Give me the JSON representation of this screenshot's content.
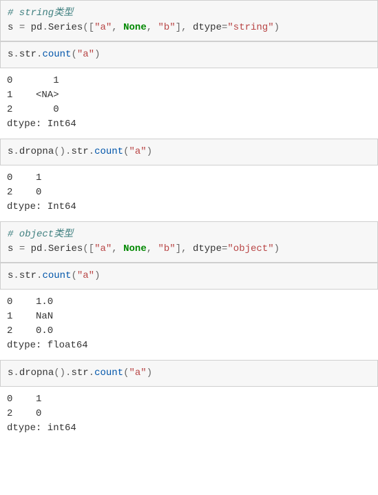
{
  "cells": [
    {
      "type": "in",
      "tokens": [
        {
          "cls": "tok-comment",
          "t": "# string类型"
        },
        {
          "cls": "",
          "t": "\n"
        },
        {
          "cls": "tok-ident",
          "t": "s "
        },
        {
          "cls": "tok-op",
          "t": "="
        },
        {
          "cls": "tok-ident",
          "t": " pd"
        },
        {
          "cls": "tok-op",
          "t": "."
        },
        {
          "cls": "tok-ident",
          "t": "Series"
        },
        {
          "cls": "tok-op",
          "t": "(["
        },
        {
          "cls": "tok-str",
          "t": "\"a\""
        },
        {
          "cls": "tok-op",
          "t": ", "
        },
        {
          "cls": "tok-kw",
          "t": "None"
        },
        {
          "cls": "tok-op",
          "t": ", "
        },
        {
          "cls": "tok-str",
          "t": "\"b\""
        },
        {
          "cls": "tok-op",
          "t": "], "
        },
        {
          "cls": "tok-ident",
          "t": "dtype"
        },
        {
          "cls": "tok-op",
          "t": "="
        },
        {
          "cls": "tok-str",
          "t": "\"string\""
        },
        {
          "cls": "tok-op",
          "t": ")"
        }
      ]
    },
    {
      "type": "in",
      "tokens": [
        {
          "cls": "tok-ident",
          "t": "s"
        },
        {
          "cls": "tok-op",
          "t": "."
        },
        {
          "cls": "tok-ident",
          "t": "str"
        },
        {
          "cls": "tok-op",
          "t": "."
        },
        {
          "cls": "tok-func",
          "t": "count"
        },
        {
          "cls": "tok-op",
          "t": "("
        },
        {
          "cls": "tok-str",
          "t": "\"a\""
        },
        {
          "cls": "tok-op",
          "t": ")"
        }
      ]
    },
    {
      "type": "out",
      "text": "0       1\n1    <NA>\n2       0\ndtype: Int64"
    },
    {
      "type": "in",
      "tokens": [
        {
          "cls": "tok-ident",
          "t": "s"
        },
        {
          "cls": "tok-op",
          "t": "."
        },
        {
          "cls": "tok-ident",
          "t": "dropna"
        },
        {
          "cls": "tok-op",
          "t": "()."
        },
        {
          "cls": "tok-ident",
          "t": "str"
        },
        {
          "cls": "tok-op",
          "t": "."
        },
        {
          "cls": "tok-func",
          "t": "count"
        },
        {
          "cls": "tok-op",
          "t": "("
        },
        {
          "cls": "tok-str",
          "t": "\"a\""
        },
        {
          "cls": "tok-op",
          "t": ")"
        }
      ]
    },
    {
      "type": "out",
      "text": "0    1\n2    0\ndtype: Int64"
    },
    {
      "type": "in",
      "tokens": [
        {
          "cls": "tok-comment",
          "t": "# object类型"
        },
        {
          "cls": "",
          "t": "\n"
        },
        {
          "cls": "tok-ident",
          "t": "s "
        },
        {
          "cls": "tok-op",
          "t": "="
        },
        {
          "cls": "tok-ident",
          "t": " pd"
        },
        {
          "cls": "tok-op",
          "t": "."
        },
        {
          "cls": "tok-ident",
          "t": "Series"
        },
        {
          "cls": "tok-op",
          "t": "(["
        },
        {
          "cls": "tok-str",
          "t": "\"a\""
        },
        {
          "cls": "tok-op",
          "t": ", "
        },
        {
          "cls": "tok-kw",
          "t": "None"
        },
        {
          "cls": "tok-op",
          "t": ", "
        },
        {
          "cls": "tok-str",
          "t": "\"b\""
        },
        {
          "cls": "tok-op",
          "t": "], "
        },
        {
          "cls": "tok-ident",
          "t": "dtype"
        },
        {
          "cls": "tok-op",
          "t": "="
        },
        {
          "cls": "tok-str",
          "t": "\"object\""
        },
        {
          "cls": "tok-op",
          "t": ")"
        }
      ]
    },
    {
      "type": "in",
      "tokens": [
        {
          "cls": "tok-ident",
          "t": "s"
        },
        {
          "cls": "tok-op",
          "t": "."
        },
        {
          "cls": "tok-ident",
          "t": "str"
        },
        {
          "cls": "tok-op",
          "t": "."
        },
        {
          "cls": "tok-func",
          "t": "count"
        },
        {
          "cls": "tok-op",
          "t": "("
        },
        {
          "cls": "tok-str",
          "t": "\"a\""
        },
        {
          "cls": "tok-op",
          "t": ")"
        }
      ]
    },
    {
      "type": "out",
      "text": "0    1.0\n1    NaN\n2    0.0\ndtype: float64"
    },
    {
      "type": "in",
      "tokens": [
        {
          "cls": "tok-ident",
          "t": "s"
        },
        {
          "cls": "tok-op",
          "t": "."
        },
        {
          "cls": "tok-ident",
          "t": "dropna"
        },
        {
          "cls": "tok-op",
          "t": "()."
        },
        {
          "cls": "tok-ident",
          "t": "str"
        },
        {
          "cls": "tok-op",
          "t": "."
        },
        {
          "cls": "tok-func",
          "t": "count"
        },
        {
          "cls": "tok-op",
          "t": "("
        },
        {
          "cls": "tok-str",
          "t": "\"a\""
        },
        {
          "cls": "tok-op",
          "t": ")"
        }
      ]
    },
    {
      "type": "out",
      "text": "0    1\n2    0\ndtype: int64"
    }
  ]
}
